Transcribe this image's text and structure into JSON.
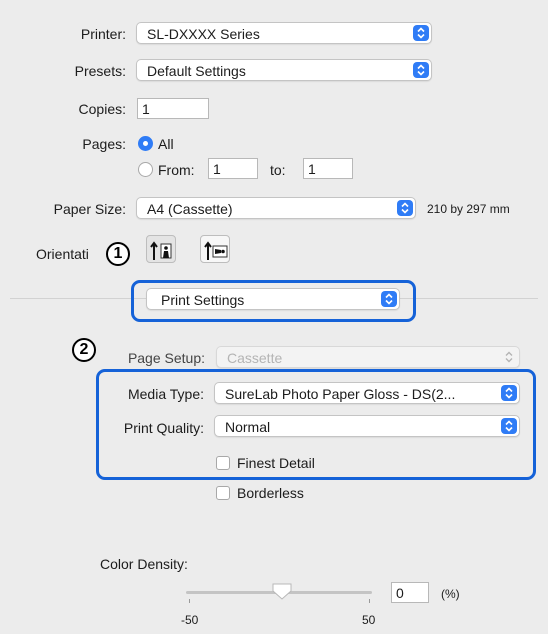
{
  "printer": {
    "label": "Printer:",
    "value": "SL-DXXXX Series"
  },
  "presets": {
    "label": "Presets:",
    "value": "Default Settings"
  },
  "copies": {
    "label": "Copies:",
    "value": "1"
  },
  "pages": {
    "label": "Pages:",
    "all_label": "All",
    "from_label": "From:",
    "from_value": "1",
    "to_label": "to:",
    "to_value": "1",
    "selected": "All"
  },
  "paper_size": {
    "label": "Paper Size:",
    "value": "A4 (Cassette)",
    "dimensions": "210 by 297 mm"
  },
  "orientation": {
    "label": "Orientati",
    "selected": "portrait"
  },
  "section_menu": {
    "value": "Print Settings"
  },
  "callouts": {
    "one": "1",
    "two": "2"
  },
  "page_setup": {
    "label": "Page Setup:",
    "value": "Cassette"
  },
  "media_type": {
    "label": "Media Type:",
    "value": "SureLab Photo Paper Gloss - DS(2..."
  },
  "print_quality": {
    "label": "Print Quality:",
    "value": "Normal"
  },
  "finest_detail": {
    "label": "Finest Detail",
    "checked": false
  },
  "borderless": {
    "label": "Borderless",
    "checked": false
  },
  "color_density": {
    "label": "Color Density:",
    "value": "0",
    "unit": "(%)",
    "min_label": "-50",
    "max_label": "50",
    "min": -50,
    "max": 50
  },
  "colors": {
    "accent": "#2f7cf6",
    "highlight": "#1562d8",
    "panel": "#ececec"
  }
}
